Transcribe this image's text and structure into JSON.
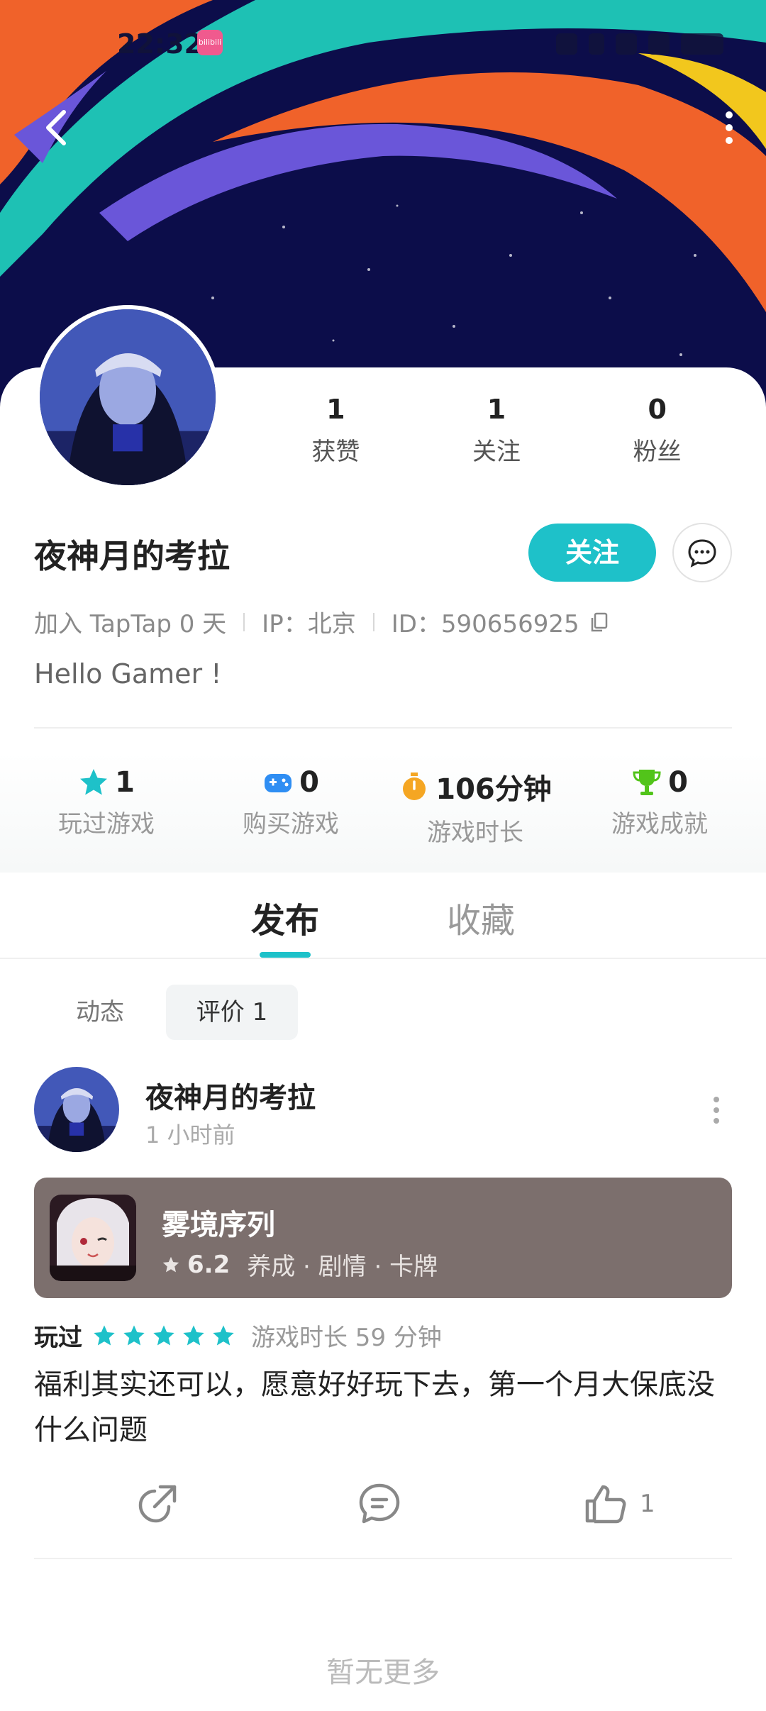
{
  "status_bar": {
    "time": "22:32",
    "app_badge": "bilibili"
  },
  "profile": {
    "stats": [
      {
        "num": "1",
        "label": "获赞"
      },
      {
        "num": "1",
        "label": "关注"
      },
      {
        "num": "0",
        "label": "粉丝"
      }
    ],
    "username": "夜神月的考拉",
    "follow_label": "关注",
    "join": "加入 TapTap 0 天",
    "ip": "IP：北京",
    "id": "ID：590656925",
    "bio": "Hello Gamer !"
  },
  "game_stats": [
    {
      "icon": "star-icon",
      "value": "1",
      "label": "玩过游戏",
      "color": "#1ec1c9"
    },
    {
      "icon": "gamepad-icon",
      "value": "0",
      "label": "购买游戏",
      "color": "#2f8ef3"
    },
    {
      "icon": "stopwatch-icon",
      "value": "106分钟",
      "label": "游戏时长",
      "color": "#f5a623"
    },
    {
      "icon": "trophy-icon",
      "value": "0",
      "label": "游戏成就",
      "color": "#52c41a"
    }
  ],
  "tabs": [
    "发布",
    "收藏"
  ],
  "subtabs": [
    "动态",
    "评价 1"
  ],
  "post": {
    "author": "夜神月的考拉",
    "time": "1 小时前",
    "game": {
      "title": "雾境序列",
      "rating": "6.2",
      "tags": "养成 · 剧情 · 卡牌"
    },
    "played_label": "玩过",
    "stars": 5,
    "play_time": "游戏时长 59 分钟",
    "text": "福利其实还可以，愿意好好玩下去，第一个月大保底没什么问题",
    "like_count": "1"
  },
  "footer": {
    "no_more": "暂无更多"
  },
  "colors": {
    "accent": "#1ec1c9",
    "banner_bg": "#0c0d4a"
  }
}
